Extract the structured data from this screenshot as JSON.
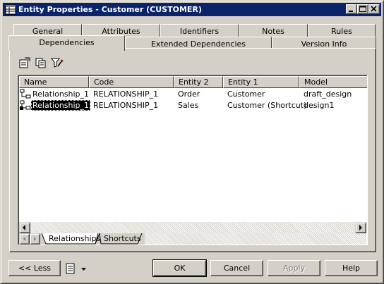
{
  "window": {
    "title": "Entity Properties - Customer (CUSTOMER)"
  },
  "tabs_row1": [
    {
      "label": "General"
    },
    {
      "label": "Attributes"
    },
    {
      "label": "Identifiers"
    },
    {
      "label": "Notes"
    },
    {
      "label": "Rules"
    }
  ],
  "tabs_row2": [
    {
      "label": "Dependencies",
      "active": true
    },
    {
      "label": "Extended Dependencies"
    },
    {
      "label": "Version Info"
    }
  ],
  "toolbar": {
    "icons": [
      "properties-icon",
      "copy-icon",
      "filter-icon"
    ]
  },
  "list": {
    "columns": [
      "Name",
      "Code",
      "Entity 2",
      "Entity 1",
      "Model"
    ],
    "rows": [
      {
        "name": "Relationship_1",
        "code": "RELATIONSHIP_1",
        "entity2": "Order",
        "entity1": "Customer",
        "model": "draft_design"
      },
      {
        "name": "Relationship_1",
        "code": "RELATIONSHIP_1",
        "entity2": "Sales",
        "entity1": "Customer (Shortcut)",
        "model": "design1",
        "selected": true
      }
    ]
  },
  "subtabs": [
    {
      "label": "Relationships",
      "active": true
    },
    {
      "label": "Shortcuts"
    }
  ],
  "footer": {
    "less_label": "<< Less",
    "ok_label": "OK",
    "cancel_label": "Cancel",
    "apply_label": "Apply",
    "help_label": "Help"
  }
}
